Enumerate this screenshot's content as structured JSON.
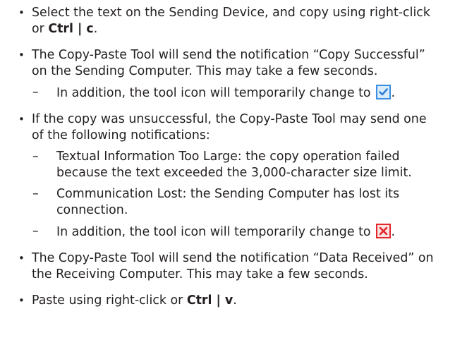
{
  "steps": [
    {
      "line1": "Select the text on the Sending Device, and copy using right-click",
      "line2_a": "or ",
      "line2_bold": "Ctrl | c",
      "line2_b": "."
    },
    {
      "line1": "The Copy-Paste Tool will send the notification “Copy Successful”",
      "line2": "on the Sending Computer. This may take a few seconds.",
      "sub": {
        "text": "In addition, the tool icon will temporarily change to",
        "icon": "check-icon",
        "end": "."
      }
    },
    {
      "line1": "If the copy was unsuccessful, the Copy-Paste Tool may send one",
      "line2": "of the following notifications:",
      "subs": [
        {
          "line1": "Textual Information Too Large: the copy operation failed",
          "line2": "because the text exceeded the 3,000-character size limit."
        },
        {
          "line1": "Communication Lost: the Sending Computer has lost its",
          "line2": "connection."
        },
        {
          "line1": "In addition, the tool icon will temporarily change to",
          "icon": "x-icon",
          "end": "."
        }
      ]
    },
    {
      "line1": "The Copy-Paste Tool will send the notification “Data Received” on",
      "line2": "the Receiving Computer. This may take a few seconds."
    },
    {
      "text_a": "Paste using right-click or ",
      "text_bold": "Ctrl | v",
      "text_b": "."
    }
  ],
  "bullet_marker": "•",
  "sub_marker": "–",
  "colors": {
    "text": "#231f20",
    "check_icon": "#3a8de0",
    "x_icon": "#e3262b"
  }
}
